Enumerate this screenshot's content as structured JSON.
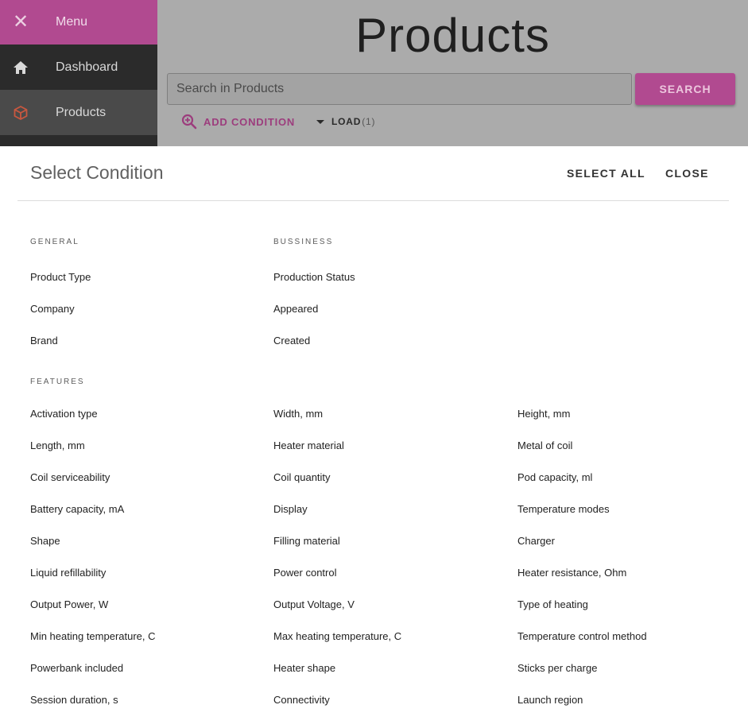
{
  "sidebar": {
    "menu_label": "Menu",
    "items": [
      {
        "label": "Dashboard",
        "icon": "home-icon"
      },
      {
        "label": "Products",
        "icon": "box-icon"
      }
    ]
  },
  "header": {
    "title": "Products",
    "search_placeholder": "Search in Products",
    "search_button": "SEARCH",
    "add_condition": "ADD CONDITION",
    "load_label": "LOAD",
    "load_count": "(1)"
  },
  "dialog": {
    "title": "Select Condition",
    "select_all": "SELECT ALL",
    "close": "CLOSE",
    "sections": {
      "general": {
        "label": "GENERAL",
        "items": [
          "Product Type",
          "Company",
          "Brand"
        ]
      },
      "bussiness": {
        "label": "BUSSINESS",
        "items": [
          "Production Status",
          "Appeared",
          "Created"
        ]
      },
      "features": {
        "label": "FEATURES",
        "columns": [
          [
            "Activation type",
            "Length, mm",
            "Coil serviceability",
            "Battery capacity, mA",
            "Shape",
            "Liquid refillability",
            "Output Power, W",
            "Min heating temperature, C",
            "Powerbank included",
            "Session duration, s"
          ],
          [
            "Width, mm",
            "Heater material",
            "Coil quantity",
            "Display",
            "Filling material",
            "Power control",
            "Output Voltage, V",
            "Max heating temperature, C",
            "Heater shape",
            "Connectivity"
          ],
          [
            "Height, mm",
            "Metal of coil",
            "Pod capacity, ml",
            "Temperature modes",
            "Charger",
            "Heater resistance, Ohm",
            "Type of heating",
            "Temperature control method",
            "Sticks per charge",
            "Launch region"
          ]
        ]
      }
    }
  },
  "colors": {
    "accent": "#b14a90",
    "sidebar": "#2b2b2b",
    "overlay_bg": "#ababab"
  }
}
